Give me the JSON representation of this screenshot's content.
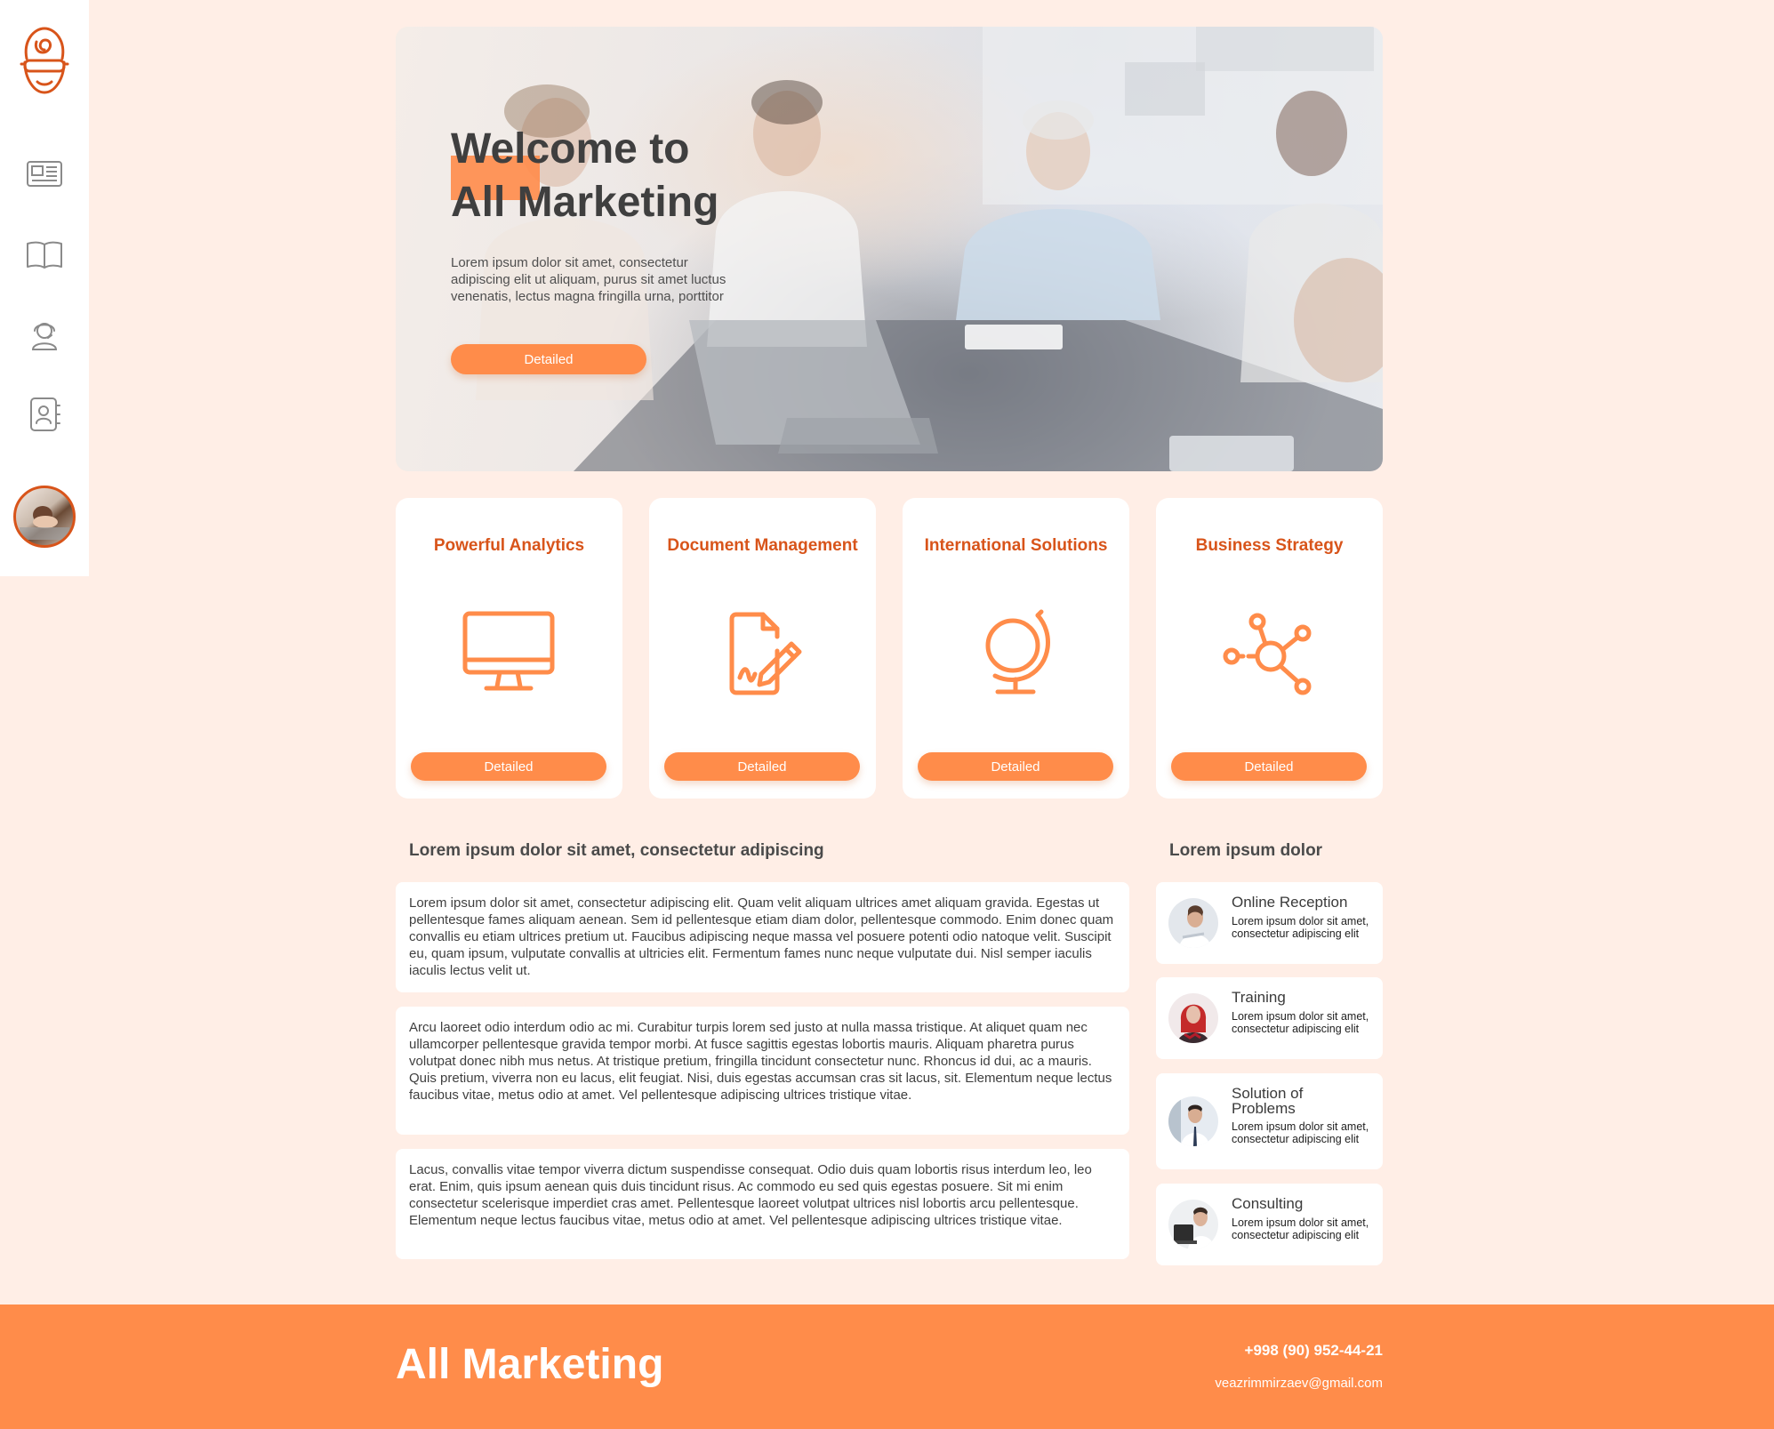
{
  "colors": {
    "accent": "#ff8c4a",
    "accent_dark": "#d8541a",
    "background": "#ffeee6",
    "card": "#ffffff"
  },
  "sidebar": {
    "items": [
      {
        "icon": "newspaper-icon"
      },
      {
        "icon": "book-icon"
      },
      {
        "icon": "support-agent-icon"
      },
      {
        "icon": "contacts-book-icon"
      }
    ],
    "logo_icon": "hypnotized-face-logo",
    "avatar_icon": "user-avatar"
  },
  "hero": {
    "title_line1": "Welcome to",
    "title_line2": "All Marketing",
    "text": "Lorem ipsum dolor sit amet, consectetur adipiscing elit ut aliquam, purus sit amet luctus venenatis, lectus magna fringilla urna, porttitor",
    "button_label": "Detailed"
  },
  "cards": [
    {
      "title": "Powerful Analytics",
      "icon": "monitor-icon",
      "button_label": "Detailed"
    },
    {
      "title": "Document Management",
      "icon": "document-sign-icon",
      "button_label": "Detailed"
    },
    {
      "title": "International Solutions",
      "icon": "globe-icon",
      "button_label": "Detailed"
    },
    {
      "title": "Business Strategy",
      "icon": "network-nodes-icon",
      "button_label": "Detailed"
    }
  ],
  "main": {
    "title": "Lorem ipsum dolor sit amet, consectetur adipiscing",
    "paragraphs": [
      "Lorem ipsum dolor sit amet, consectetur adipiscing elit. Quam velit aliquam ultrices amet aliquam gravida. Egestas ut pellentesque fames aliquam aenean. Sem id pellentesque etiam diam dolor, pellentesque commodo. Enim donec quam convallis eu etiam ultrices pretium ut. Faucibus adipiscing neque massa vel posuere potenti odio natoque velit. Suscipit eu, quam ipsum, vulputate convallis at ultricies elit. Fermentum fames nunc neque vulputate dui. Nisl semper iaculis iaculis lectus velit ut.",
      "Arcu laoreet odio interdum odio ac mi. Curabitur turpis lorem sed justo at nulla massa tristique. At aliquet quam nec ullamcorper pellentesque gravida tempor morbi. At fusce sagittis egestas lobortis mauris. Aliquam pharetra purus volutpat donec nibh mus netus. At tristique pretium, fringilla tincidunt consectetur nunc. Rhoncus id dui, ac a mauris. Quis pretium, viverra non eu lacus, elit feugiat. Nisi, duis egestas accumsan cras sit lacus, sit. Elementum neque lectus faucibus vitae, metus odio at amet. Vel pellentesque adipiscing ultrices tristique vitae.",
      "Lacus, convallis vitae tempor viverra dictum suspendisse consequat. Odio duis quam lobortis risus interdum leo, leo erat. Enim, quis ipsum aenean quis duis tincidunt risus. Ac commodo eu sed quis egestas posuere. Sit mi enim consectetur scelerisque imperdiet cras amet. Pellentesque laoreet volutpat ultrices nisl lobortis arcu pellentesque. Elementum neque lectus faucibus vitae, metus odio at amet. Vel pellentesque adipiscing ultrices tristique vitae."
    ]
  },
  "services": {
    "title": "Lorem ipsum dolor",
    "items": [
      {
        "name": "Online Reception",
        "desc": "Lorem ipsum dolor sit amet, consectetur adipiscing elit"
      },
      {
        "name": "Training",
        "desc": "Lorem ipsum dolor sit amet, consectetur adipiscing elit"
      },
      {
        "name": "Solution of Problems",
        "desc": "Lorem ipsum dolor sit amet, consectetur adipiscing elit"
      },
      {
        "name": "Consulting",
        "desc": "Lorem ipsum dolor sit amet, consectetur adipiscing elit"
      }
    ]
  },
  "footer": {
    "brand": "All Marketing",
    "phone": "+998 (90) 952-44-21",
    "email": "veazrimmirzaev@gmail.com"
  }
}
